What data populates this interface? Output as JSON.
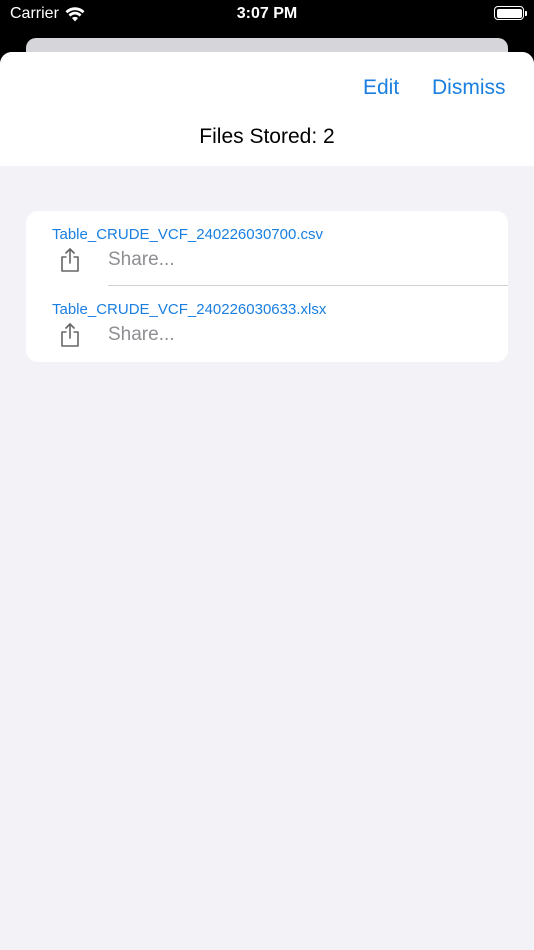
{
  "status_bar": {
    "carrier": "Carrier",
    "time": "3:07 PM",
    "battery_level": 100
  },
  "nav": {
    "edit_label": "Edit",
    "dismiss_label": "Dismiss",
    "title": "Files Stored: 2"
  },
  "files": [
    {
      "name": "Table_CRUDE_VCF_240226030700.csv",
      "action_label": "Share...",
      "icon": "share-icon"
    },
    {
      "name": "Table_CRUDE_VCF_240226030633.xlsx",
      "action_label": "Share...",
      "icon": "share-icon"
    }
  ],
  "colors": {
    "accent": "#1a7fe0",
    "secondary_text": "#8e8e93",
    "grouped_background": "#f2f2f7"
  }
}
